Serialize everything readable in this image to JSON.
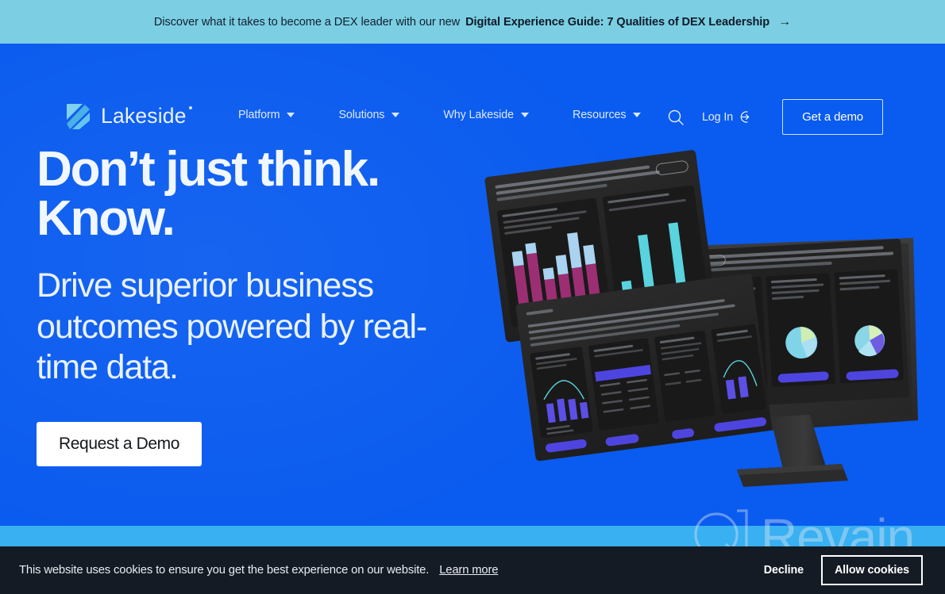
{
  "announcement": {
    "text": "Discover what it takes to become a DEX leader with our new",
    "link_label": "Digital Experience Guide: 7 Qualities of DEX Leadership",
    "arrow_icon": "arrow-right-icon"
  },
  "brand": {
    "name": "Lakeside",
    "logo_icon": "lakeside-logo-icon",
    "trademark_dot": ""
  },
  "nav": {
    "items": [
      {
        "label": "Platform",
        "caret_icon": "chevron-down-icon"
      },
      {
        "label": "Solutions",
        "caret_icon": "chevron-down-icon"
      },
      {
        "label": "Why Lakeside",
        "caret_icon": "chevron-down-icon"
      },
      {
        "label": "Resources",
        "caret_icon": "chevron-down-icon"
      }
    ],
    "search_icon": "search-icon",
    "login_label": "Log In",
    "login_icon": "login-arrow-icon",
    "demo_label": "Get a demo"
  },
  "hero": {
    "headline_line1": "Don’t just think.",
    "headline_line2": "Know.",
    "subheadline": "Drive superior business outcomes powered by real-time data.",
    "cta_label": "Request a Demo",
    "illustration_name": "lakeside-dashboard-monitor-image"
  },
  "watermark": {
    "label": "Revain",
    "logo_icon": "revain-logo-icon"
  },
  "cookie_banner": {
    "message": "This website uses cookies to ensure you get the best experience on our website.",
    "learn_more_label": "Learn more",
    "decline_label": "Decline",
    "allow_label": "Allow cookies"
  },
  "colors": {
    "announce_bg": "#7ccfe3",
    "hero_bg": "#0a5bef",
    "strip": "#38b0f2",
    "cookie_bg": "#141b24",
    "cta_bg": "#ffffff",
    "accent_purple": "#4e45e0",
    "chart_magenta": "#9c2f73",
    "chart_cyan": "#59d3dd"
  }
}
